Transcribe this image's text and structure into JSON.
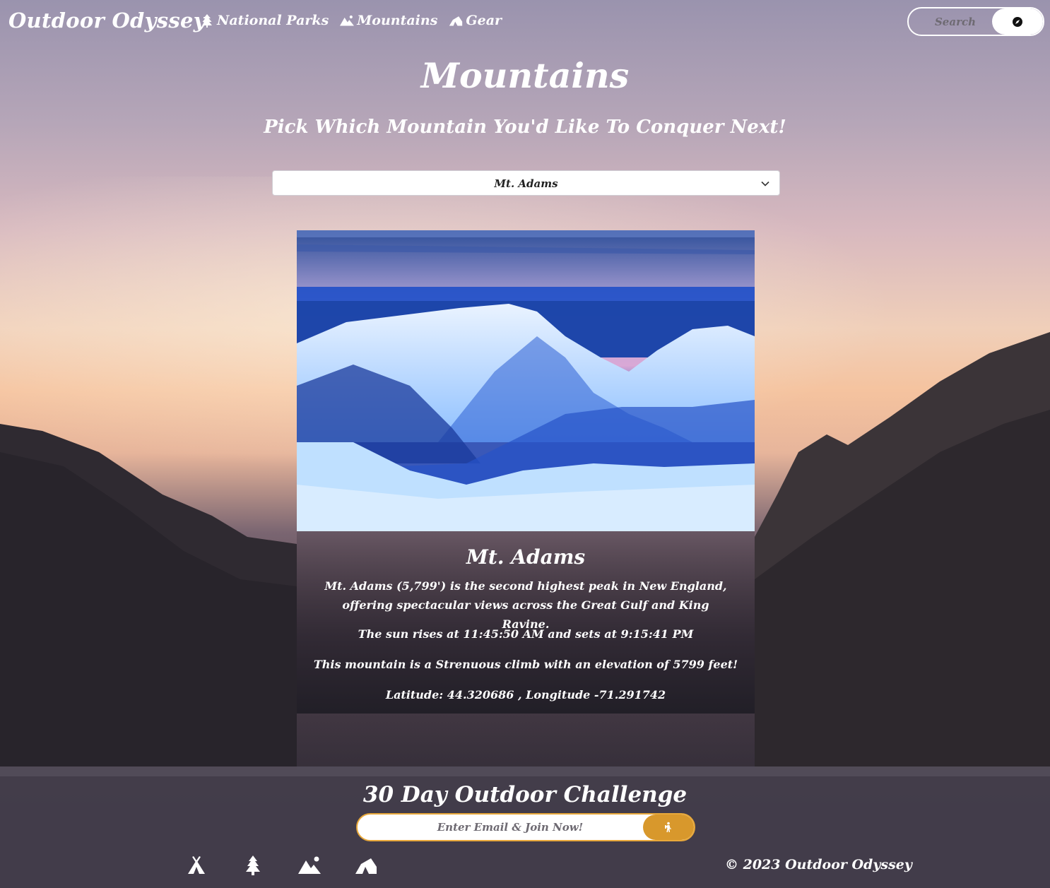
{
  "nav": {
    "brand": "Outdoor Odyssey",
    "links": [
      {
        "label": "National Parks",
        "icon": "tree-icon"
      },
      {
        "label": "Mountains",
        "icon": "mountain-icon"
      },
      {
        "label": "Gear",
        "icon": "tent-icon"
      }
    ],
    "search_placeholder": "Search",
    "search_icon": "compass-icon"
  },
  "page": {
    "title": "Mountains",
    "subtitle": "Pick Which Mountain You'd Like To Conquer Next!"
  },
  "mountain_select": {
    "selected": "Mt. Adams"
  },
  "card": {
    "title": "Mt. Adams",
    "description": "Mt. Adams (5,799') is the second highest peak in New England, offering spectacular views across the Great Gulf and King Ravine.",
    "sun": "The sun rises at 11:45:50 AM and sets at 9:15:41 PM",
    "difficulty": "This mountain is a Strenuous climb with an elevation of 5799 feet!",
    "coords": "Latitude: 44.320686 , Longitude -71.291742"
  },
  "footer": {
    "challenge_title": "30 Day Outdoor Challenge",
    "email_placeholder": "Enter Email & Join Now!",
    "join_icon": "hiker-icon",
    "icons": [
      "campfire-tent-icon",
      "tree-icon",
      "mountain-icon",
      "tent-icon"
    ],
    "copyright": "© 2023 Outdoor Odyssey"
  },
  "colors": {
    "accent": "#d8982c",
    "accent_border": "#e8a83a",
    "text": "#ffffff"
  }
}
